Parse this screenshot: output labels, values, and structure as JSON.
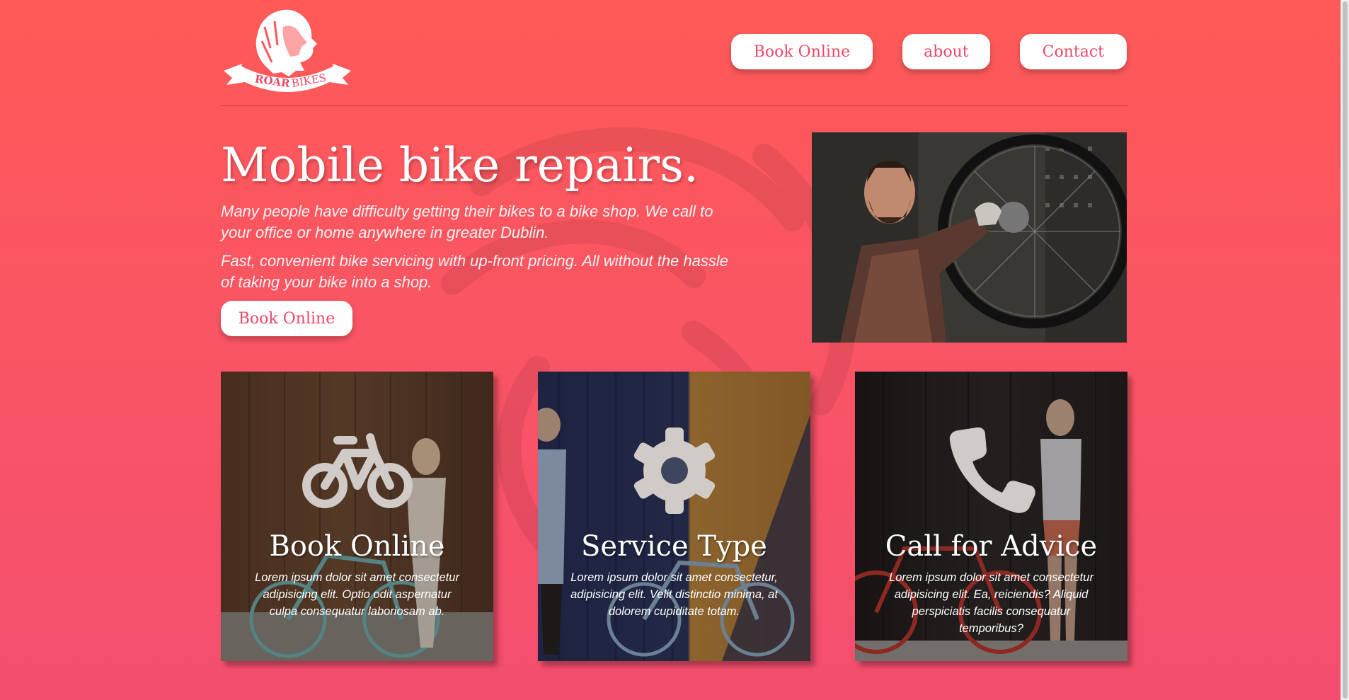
{
  "brand": {
    "logo_text_bold": "ROAR",
    "logo_text": "BIKES",
    "logo_icon": "lion-head-icon"
  },
  "nav": {
    "items": [
      {
        "label": "Book Online"
      },
      {
        "label": "about"
      },
      {
        "label": "Contact"
      }
    ]
  },
  "hero": {
    "title": "Mobile bike repairs.",
    "paragraph_1": "Many people have difficulty getting their bikes to a bike shop. We call to your office or home anywhere in greater Dublin.",
    "paragraph_2": "Fast, convenient bike servicing with up-front pricing. All without the hassle of taking your bike into a shop.",
    "cta_label": "Book Online",
    "photo": "mechanic-repairing-bicycle-wheel-photo"
  },
  "cards": [
    {
      "title": "Book Online",
      "text": "Lorem ipsum dolor sit amet consectetur adipisicing elit. Optio odit aspernatur culpa consequatur laboriosam ab.",
      "icon": "bicycle-icon"
    },
    {
      "title": "Service Type",
      "text": "Lorem ipsum dolor sit amet consectetur, adipisicing elit. Velit distinctio minima, at dolorem cupiditate totam.",
      "icon": "gear-icon"
    },
    {
      "title": "Call for Advice",
      "text": "Lorem ipsum dolor sit amet consectetur adipisicing elit. Ea, reiciendis? Aliquid perspiciatis facilis consequatur temporibus?",
      "icon": "phone-icon"
    }
  ],
  "colors": {
    "background_top": "#fe5a57",
    "background_bottom": "#f34e6e",
    "button_bg": "#ffffff",
    "button_text": "#e8496a"
  }
}
